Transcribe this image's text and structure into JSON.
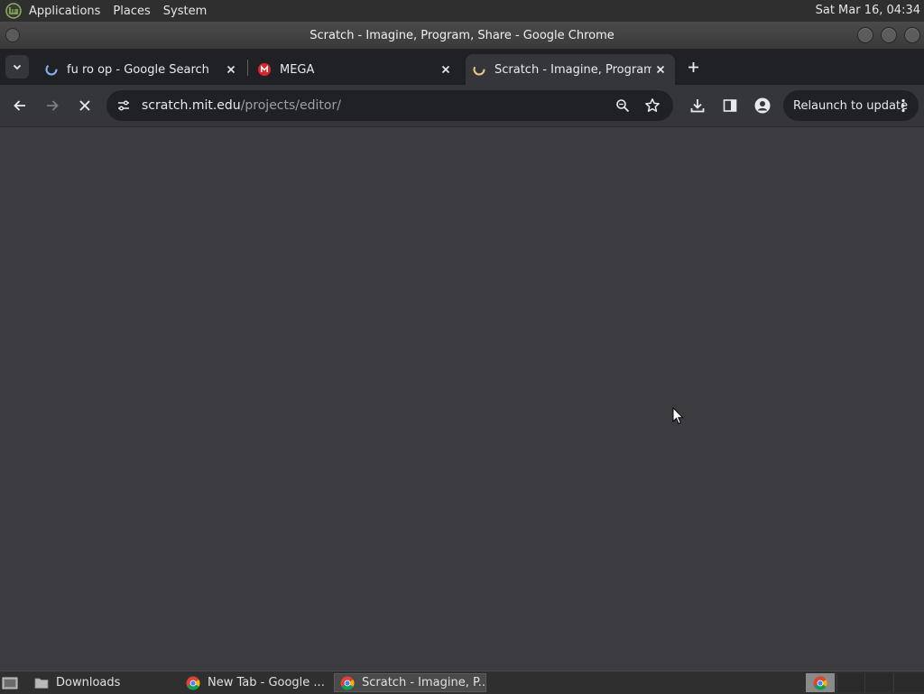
{
  "top_panel": {
    "menus": [
      "Applications",
      "Places",
      "System"
    ],
    "clock": "Sat Mar 16, 04:34",
    "logo_icon": "mint-logo-icon"
  },
  "window": {
    "title": "Scratch - Imagine, Program, Share - Google Chrome"
  },
  "tabs": [
    {
      "title": "fu ro op - Google Search",
      "favicon": "google-loading-icon",
      "active": false
    },
    {
      "title": "MEGA",
      "favicon": "mega-icon",
      "active": false
    },
    {
      "title": "Scratch - Imagine, Program, Share",
      "favicon": "scratch-loading-icon",
      "active": true
    }
  ],
  "toolbar": {
    "url_host": "scratch.mit.edu",
    "url_path": "/projects/editor/",
    "relaunch_label": "Relaunch to update"
  },
  "taskbar": {
    "items": [
      {
        "label": "Downloads",
        "icon": "folder-icon",
        "active": false
      },
      {
        "label": "New Tab - Google ...",
        "icon": "chrome-icon",
        "active": false
      },
      {
        "label": "Scratch - Imagine, P...",
        "icon": "chrome-icon",
        "active": true
      }
    ]
  },
  "colors": {
    "page_bg": "#3c3c40",
    "tabstrip_bg": "#202124",
    "toolbar_bg": "#35363a",
    "mega_red": "#d9272e"
  }
}
